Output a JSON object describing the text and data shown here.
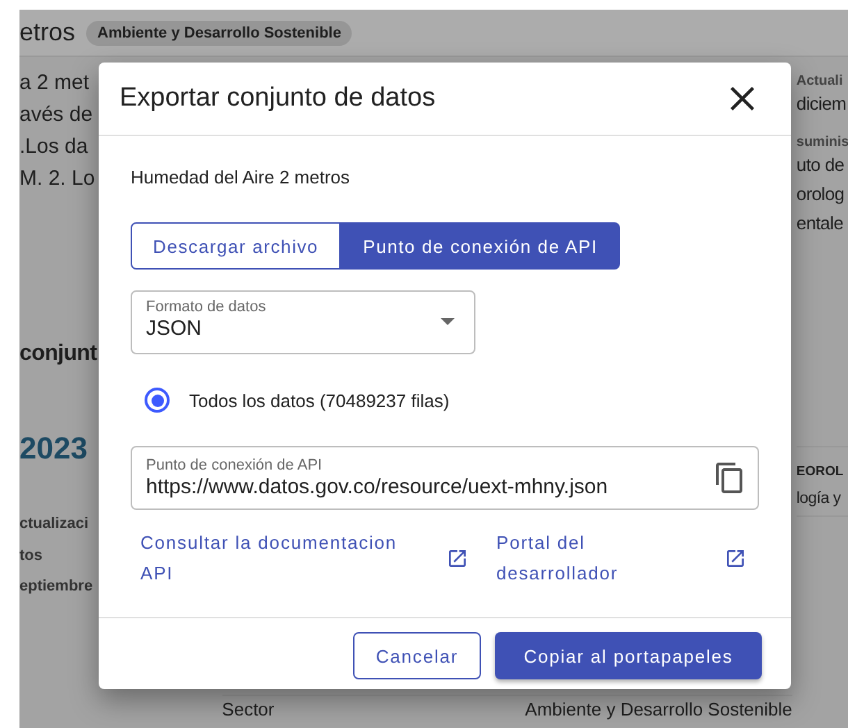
{
  "background": {
    "header_title": "etros",
    "header_tag": "Ambiente y Desarrollo Sostenible",
    "left_lines": [
      "a 2 met",
      "avés de",
      ".Los da",
      "M. 2. Lo"
    ],
    "right_blocks": [
      {
        "label": "Actuali",
        "value_lines": [
          "diciem"
        ]
      },
      {
        "label": "suminis",
        "value_lines": [
          "uto de",
          "orolog",
          "entale"
        ]
      }
    ],
    "section_heading": "conjunt",
    "year": "2023",
    "meta_lines": [
      "ctualizaci",
      "tos",
      "eptiembre"
    ],
    "right_table_cells": [
      "EOROL",
      "logía y"
    ],
    "bottom_row": {
      "label": "Sector",
      "value": "Ambiente y Desarrollo Sostenible"
    }
  },
  "dialog": {
    "title": "Exportar conjunto de datos",
    "dataset_name": "Humedad del Aire 2 metros",
    "tabs": [
      {
        "label": "Descargar archivo",
        "selected": false
      },
      {
        "label": "Punto de conexión de API",
        "selected": true
      }
    ],
    "format_select": {
      "label": "Formato de datos",
      "value": "JSON"
    },
    "options": [
      {
        "label": "Todos los datos (70489237 filas)",
        "selected": true
      }
    ],
    "endpoint_field": {
      "label": "Punto de conexión de API",
      "value": "https://www.datos.gov.co/resource/uext-mhny.json"
    },
    "links": [
      "Consultar la documentacion API",
      "Portal del desarrollador"
    ],
    "buttons": [
      {
        "label": "Cancelar",
        "kind": "outlined"
      },
      {
        "label": "Copiar al portapapeles",
        "kind": "filled"
      }
    ]
  }
}
